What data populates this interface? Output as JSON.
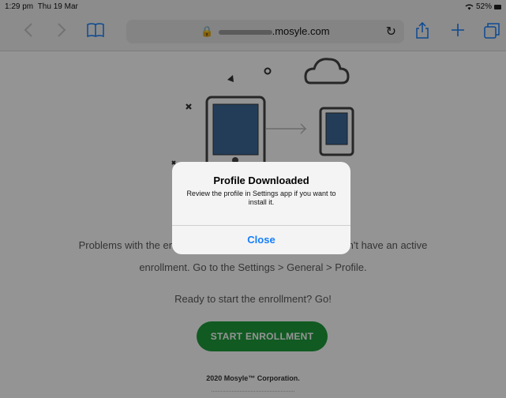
{
  "status": {
    "time": "1:29 pm",
    "date": "Thu 19 Mar",
    "battery": "52%"
  },
  "toolbar": {
    "back_icon": "chevron-left-icon",
    "forward_icon": "chevron-right-icon",
    "bookmarks_icon": "book-icon",
    "url_domain": ".mosyle.com",
    "share_icon": "share-icon",
    "new_tab_icon": "plus-icon",
    "tabs_icon": "tabs-icon"
  },
  "page": {
    "message_line1": "Problems with the enrollment? Make sure your device doesn't have an active",
    "message_line2": "enrollment. Go to the Settings > General > Profile.",
    "ready": "Ready to start the enrollment? Go!",
    "cta": "START ENROLLMENT",
    "footer": "2020 Mosyle™ Corporation."
  },
  "alert": {
    "title": "Profile Downloaded",
    "message": "Review the profile in Settings app if you want to install it.",
    "button": "Close"
  }
}
